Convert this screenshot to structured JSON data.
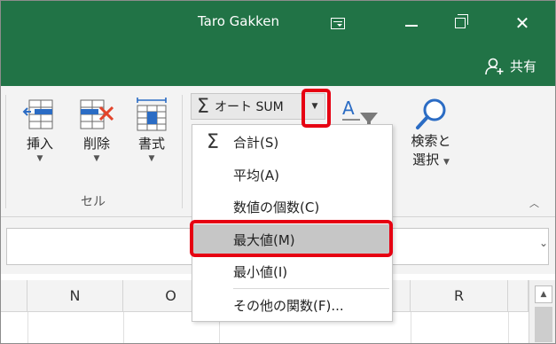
{
  "titlebar": {
    "user": "Taro Gakken"
  },
  "share": {
    "label": "共有"
  },
  "ribbon": {
    "cells_group": {
      "label": "セル",
      "insert": "挿入",
      "delete": "削除",
      "format": "書式"
    },
    "autosum": {
      "label": "オート SUM"
    },
    "find_select": {
      "line1": "検索と",
      "line2": "選択"
    }
  },
  "menu": {
    "items": [
      {
        "label": "合計(S)",
        "icon": "sigma"
      },
      {
        "label": "平均(A)"
      },
      {
        "label": "数値の個数(C)"
      },
      {
        "label": "最大値(M)",
        "selected": true
      },
      {
        "label": "最小値(I)"
      },
      {
        "label": "その他の関数(F)..."
      }
    ]
  },
  "grid": {
    "columns": [
      "N",
      "O",
      "R"
    ]
  },
  "colors": {
    "title_bg": "#217346",
    "highlight": "#e60012"
  }
}
